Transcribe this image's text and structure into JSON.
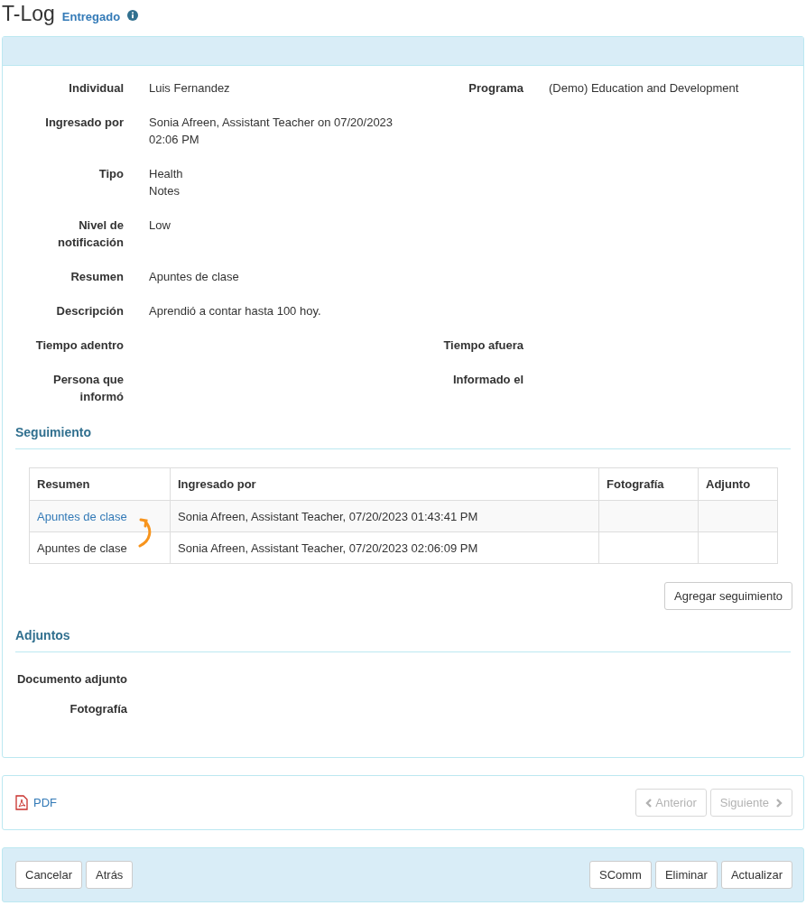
{
  "page": {
    "title": "T-Log",
    "status": "Entregado"
  },
  "details": [
    {
      "fields": [
        {
          "label": "Individual",
          "value": [
            "Luis Fernandez"
          ]
        },
        {
          "label": "Programa",
          "value": [
            "(Demo) Education and Development"
          ]
        }
      ]
    },
    {
      "fields": [
        {
          "label": "Ingresado por",
          "value": [
            "Sonia Afreen, Assistant Teacher on 07/20/2023 02:06 PM"
          ]
        }
      ]
    },
    {
      "fields": [
        {
          "label": "Tipo",
          "value": [
            "Health",
            "Notes"
          ]
        }
      ]
    },
    {
      "fields": [
        {
          "label": "Nivel de notificación",
          "value": [
            "Low"
          ]
        }
      ]
    },
    {
      "fields": [
        {
          "label": "Resumen",
          "value": [
            "Apuntes de clase"
          ]
        }
      ]
    },
    {
      "fields": [
        {
          "label": "Descripción",
          "value": [
            "Aprendió a contar hasta 100 hoy."
          ]
        }
      ]
    },
    {
      "fields": [
        {
          "label": "Tiempo adentro"
        },
        {
          "label": "Tiempo afuera"
        }
      ]
    },
    {
      "fields": [
        {
          "label": "Persona que informó"
        },
        {
          "label": "Informado el"
        }
      ]
    }
  ],
  "followup": {
    "heading": "Seguimiento",
    "columns": [
      "Resumen",
      "Ingresado por",
      "Fotografía",
      "Adjunto"
    ],
    "rows": [
      {
        "summary": "Apuntes de clase",
        "kind": "link",
        "entered_by": "Sonia Afreen, Assistant Teacher, 07/20/2023 01:43:41 PM"
      },
      {
        "summary": "Apuntes de clase",
        "kind": "text",
        "entered_by": "Sonia Afreen, Assistant Teacher, 07/20/2023 02:06:09 PM"
      }
    ],
    "add_button": "Agregar seguimiento"
  },
  "attachments": {
    "heading": "Adjuntos",
    "fields": [
      {
        "label": "Documento adjunto"
      },
      {
        "label": "Fotografía"
      }
    ]
  },
  "nav": {
    "pdf": "PDF",
    "prev": {
      "label": "Anterior",
      "disabled": true
    },
    "next": {
      "label": "Siguiente",
      "disabled": true
    }
  },
  "actions": {
    "left": [
      "Cancelar",
      "Atrás"
    ],
    "right": [
      "SComm",
      "Eliminar",
      "Actualizar"
    ]
  }
}
